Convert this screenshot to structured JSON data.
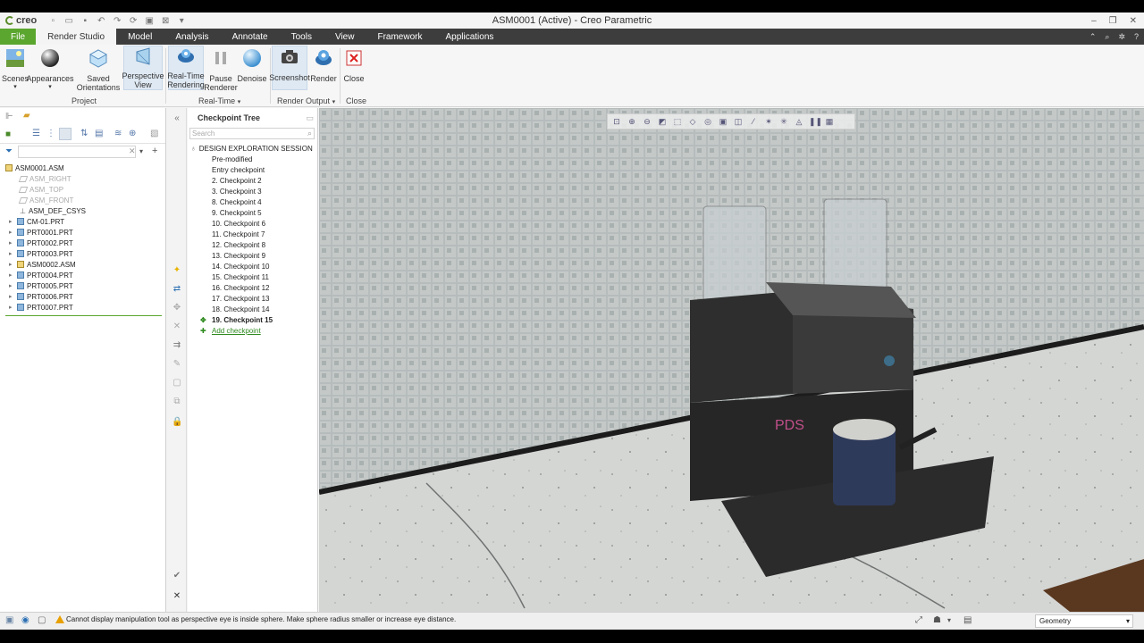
{
  "app": {
    "logo_text": "creo",
    "window_title": "ASM0001 (Active) - Creo Parametric"
  },
  "tabs": [
    {
      "label": "File"
    },
    {
      "label": "Render Studio"
    },
    {
      "label": "Model"
    },
    {
      "label": "Analysis"
    },
    {
      "label": "Annotate"
    },
    {
      "label": "Tools"
    },
    {
      "label": "View"
    },
    {
      "label": "Framework"
    },
    {
      "label": "Applications"
    }
  ],
  "ribbon": {
    "scenes": "Scenes",
    "appearances": "Appearances",
    "saved_orientations": "Saved\nOrientations",
    "perspective_view": "Perspective\nView",
    "realtime_rendering": "Real-Time\nRendering",
    "pause_renderer": "Pause\nRenderer",
    "denoise": "Denoise",
    "screenshot": "Screenshot",
    "render": "Render",
    "close": "Close",
    "group_project": "Project",
    "group_realtime": "Real-Time",
    "group_render_output": "Render Output",
    "group_close": "Close"
  },
  "model_tree": {
    "items": [
      {
        "label": "ASM0001.ASM",
        "icon": "assembly-icon"
      },
      {
        "label": "ASM_RIGHT",
        "icon": "datum-plane-icon"
      },
      {
        "label": "ASM_TOP",
        "icon": "datum-plane-icon"
      },
      {
        "label": "ASM_FRONT",
        "icon": "datum-plane-icon"
      },
      {
        "label": "ASM_DEF_CSYS",
        "icon": "csys-icon"
      },
      {
        "label": "CM-01.PRT",
        "icon": "part-icon"
      },
      {
        "label": "PRT0001.PRT",
        "icon": "part-icon"
      },
      {
        "label": "PRT0002.PRT",
        "icon": "part-icon"
      },
      {
        "label": "PRT0003.PRT",
        "icon": "part-icon"
      },
      {
        "label": "ASM0002.ASM",
        "icon": "assembly-icon"
      },
      {
        "label": "PRT0004.PRT",
        "icon": "part-icon"
      },
      {
        "label": "PRT0005.PRT",
        "icon": "part-icon"
      },
      {
        "label": "PRT0006.PRT",
        "icon": "part-icon"
      },
      {
        "label": "PRT0007.PRT",
        "icon": "part-icon"
      }
    ]
  },
  "checkpoint_tree": {
    "title": "Checkpoint Tree",
    "search_placeholder": "Search",
    "session": "DESIGN EXPLORATION SESSION",
    "items": [
      {
        "label": "Pre-modified"
      },
      {
        "label": "Entry checkpoint"
      },
      {
        "label": "2. Checkpoint 2"
      },
      {
        "label": "3. Checkpoint 3"
      },
      {
        "label": "8. Checkpoint 4"
      },
      {
        "label": "9. Checkpoint 5"
      },
      {
        "label": "10. Checkpoint 6"
      },
      {
        "label": "11. Checkpoint 7"
      },
      {
        "label": "12. Checkpoint 8"
      },
      {
        "label": "13. Checkpoint 9"
      },
      {
        "label": "14. Checkpoint 10"
      },
      {
        "label": "15. Checkpoint 11"
      },
      {
        "label": "16. Checkpoint 12"
      },
      {
        "label": "17. Checkpoint 13"
      },
      {
        "label": "18. Checkpoint 14"
      },
      {
        "label": "19. Checkpoint 15"
      }
    ],
    "add_label": "Add checkpoint"
  },
  "viewport": {
    "logo_text": "PDS"
  },
  "status": {
    "message": "Cannot display manipulation tool as perspective eye is inside sphere. Make sphere radius smaller or increase eye distance.",
    "filter_value": "Geometry"
  },
  "colors": {
    "accent_green": "#5aa62e",
    "tabbar": "#3d3d3d",
    "add_checkpoint_green": "#2f8a1f"
  }
}
